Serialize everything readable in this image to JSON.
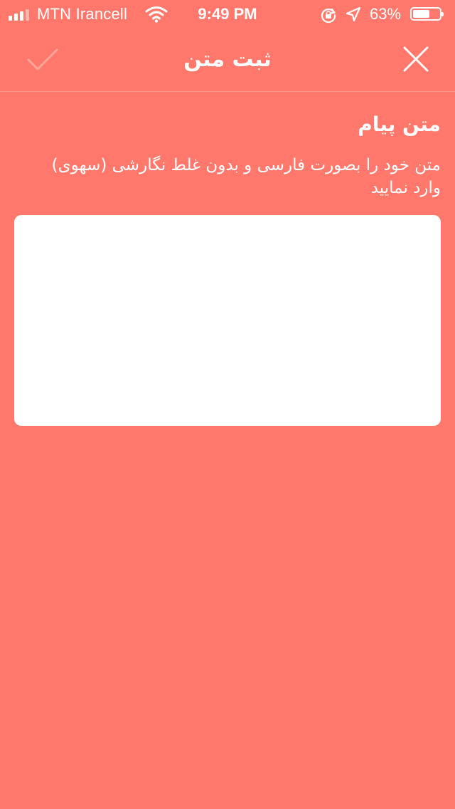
{
  "status_bar": {
    "carrier": "MTN Irancell",
    "time": "9:49 PM",
    "battery_percent_label": "63%",
    "battery_level": 0.63,
    "signal_bars_filled": 3,
    "signal_bars_total": 4,
    "icons": [
      "signal-icon",
      "wifi-icon",
      "rotation-lock-icon",
      "location-arrow-icon",
      "battery-icon"
    ]
  },
  "navbar": {
    "title": "ثبت متن",
    "confirm_icon": "checkmark-icon",
    "close_icon": "close-icon"
  },
  "form": {
    "section_title": "متن پیام",
    "hint": "متن خود را بصورت فارسی و بدون غلط نگارشی (سهوی) وارد نمایید",
    "message_value": "",
    "message_placeholder": ""
  },
  "colors": {
    "background": "#ff786b",
    "foreground": "#ffffff",
    "confirm_disabled": "#ffa59c"
  }
}
